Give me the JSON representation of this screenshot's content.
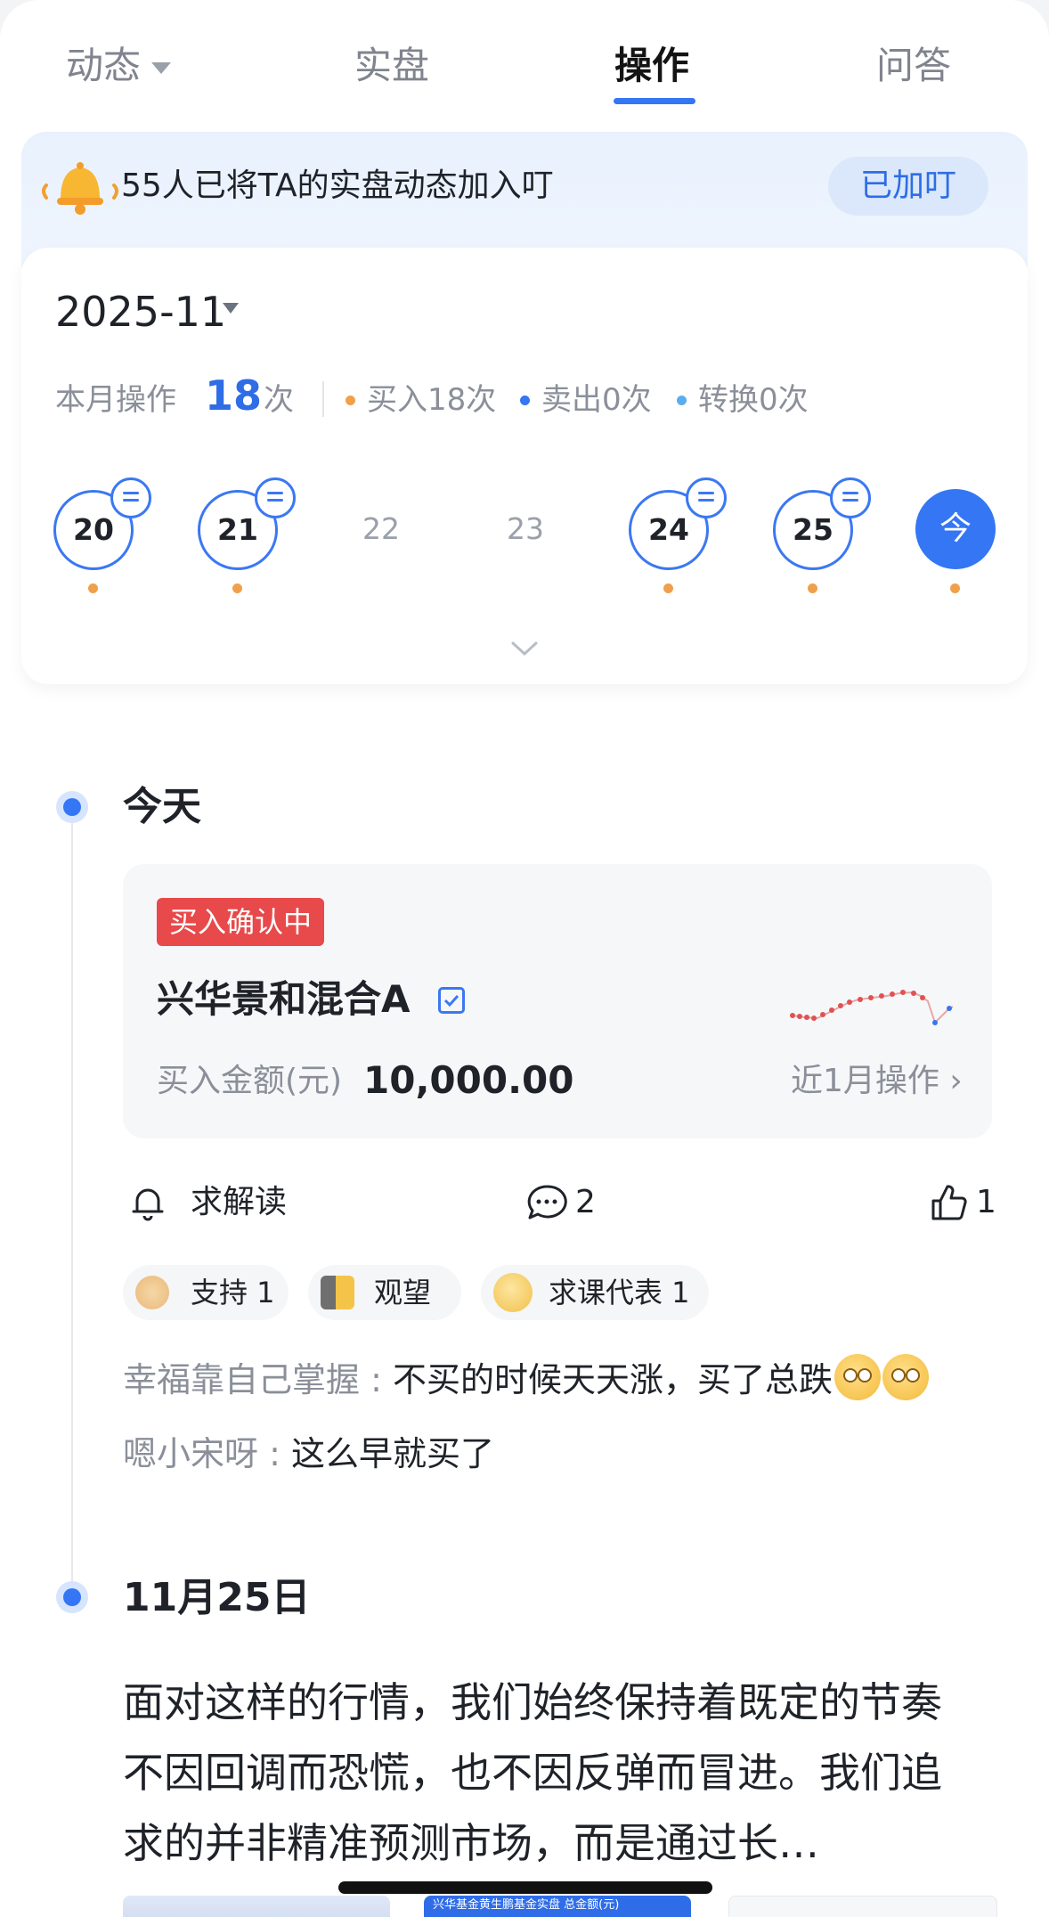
{
  "tabs": [
    {
      "label": "动态"
    },
    {
      "label": "实盘"
    },
    {
      "label": "操作"
    },
    {
      "label": "问答"
    }
  ],
  "notice": {
    "text": "55人已将TA的实盘动态加入叮",
    "button_label": "已加叮"
  },
  "calendar": {
    "month": "2025-11",
    "summary_label": "本月操作",
    "summary_count": "18",
    "summary_unit": "次",
    "stats": [
      {
        "label": "买入18次",
        "color": "#f0a04b"
      },
      {
        "label": "卖出0次",
        "color": "#3476f4"
      },
      {
        "label": "转换0次",
        "color": "#5aaef0"
      }
    ],
    "days": [
      {
        "label": "20",
        "has_message": true,
        "has_op": true
      },
      {
        "label": "21",
        "has_message": true,
        "has_op": true
      },
      {
        "label": "22",
        "has_message": false,
        "has_op": false
      },
      {
        "label": "23",
        "has_message": false,
        "has_op": false
      },
      {
        "label": "24",
        "has_message": true,
        "has_op": true
      },
      {
        "label": "25",
        "has_message": true,
        "has_op": true
      },
      {
        "label": "今",
        "has_message": false,
        "has_op": true
      }
    ]
  },
  "today": {
    "title": "今天",
    "status": "买入确认中",
    "fund_name": "兴华景和混合A",
    "amount_label": "买入金额(元)",
    "amount_value": "10,000.00",
    "recent_link": "近1月操作 ›",
    "actions": {
      "interpret": "求解读",
      "comments": "2",
      "likes": "1"
    },
    "reactions": [
      {
        "label": "支持 1",
        "icon": "clap-icon"
      },
      {
        "label": "观望",
        "icon": "peek-icon"
      },
      {
        "label": "求课代表 1",
        "icon": "plead-icon"
      }
    ],
    "comments": [
      {
        "author": "幸福靠自己掌握 : ",
        "text": "不买的时候天天涨，买了总跌"
      },
      {
        "author": "嗯小宋呀 : ",
        "text": "这么早就买了"
      }
    ]
  },
  "nov25": {
    "title": "11月25日",
    "text": "面对这样的行情，我们始终保持着既定的节奏不因回调而恐慌，也不因反弹而冒进。我们追求的并非精准预测市场，而是通过长…"
  },
  "thumb_caption": "兴华基金黄生鹏基金实盘 总金额(元)"
}
